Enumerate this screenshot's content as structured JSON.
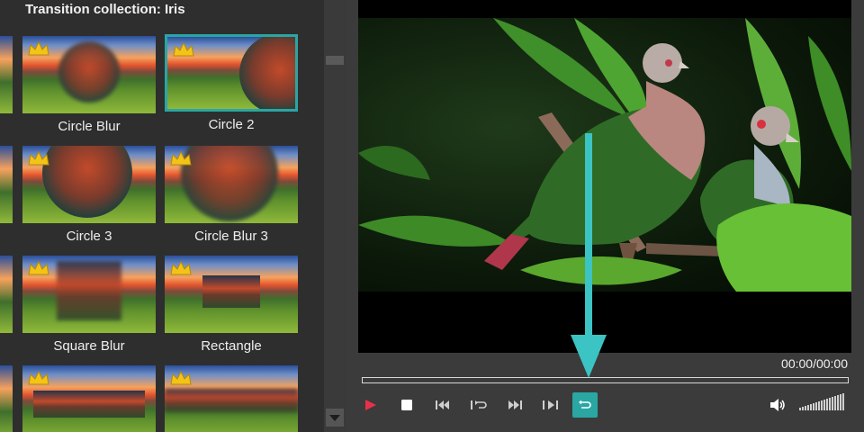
{
  "panel": {
    "title": "Transition collection: Iris"
  },
  "tiles": [
    {
      "label": "Circle Blur",
      "shape": "circle-blur",
      "selected": false,
      "premium": true
    },
    {
      "label": "Circle 2",
      "shape": "circle-right",
      "selected": true,
      "premium": true
    },
    {
      "label": "Circle 3",
      "shape": "circle-large",
      "selected": false,
      "premium": true
    },
    {
      "label": "Circle Blur 3",
      "shape": "circle-blur-large",
      "selected": false,
      "premium": true
    },
    {
      "label": "Square Blur",
      "shape": "square-blur",
      "selected": false,
      "premium": true
    },
    {
      "label": "Rectangle",
      "shape": "rectangle",
      "selected": false,
      "premium": true
    },
    {
      "label": "",
      "shape": "bar-wide",
      "selected": false,
      "premium": true
    },
    {
      "label": "",
      "shape": "bar-blur",
      "selected": false,
      "premium": true
    }
  ],
  "player": {
    "time": "00:00/00:00",
    "progress": 0
  },
  "controls": {
    "icons": [
      "play-icon",
      "stop-icon",
      "skip-back-icon",
      "step-back-icon",
      "skip-forward-icon",
      "step-forward-icon",
      "repeat-icon",
      "volume-icon",
      "volume-level-icon"
    ]
  },
  "colors": {
    "accent": "#2aa7a3",
    "play": "#e8304a",
    "selected_border": "#29a6a4"
  }
}
